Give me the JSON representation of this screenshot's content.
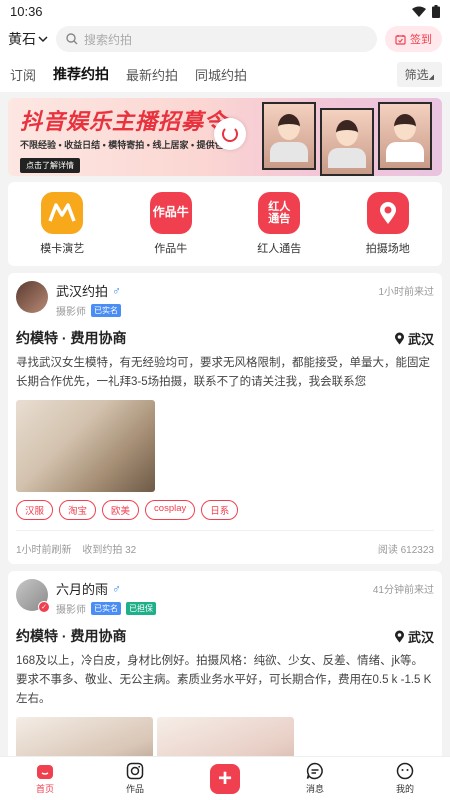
{
  "status_bar": {
    "time": "10:36"
  },
  "header": {
    "city": "黄石",
    "search_placeholder": "搜索约拍",
    "signin_label": "签到"
  },
  "tabs": [
    {
      "label": "订阅",
      "active": false
    },
    {
      "label": "推荐约拍",
      "active": true
    },
    {
      "label": "最新约拍",
      "active": false
    },
    {
      "label": "同城约拍",
      "active": false
    }
  ],
  "filter_label": "筛选",
  "banner": {
    "headline": "抖音娱乐主播招募令",
    "sub": "不限经验 • 收益日结 • 模特寄拍 • 线上居家 • 提供包住",
    "detail_button": "点击了解详情"
  },
  "quick_links": [
    {
      "label": "模卡演艺",
      "icon_text": "M",
      "icon": "m-logo-icon",
      "color": "#f7a81b"
    },
    {
      "label": "作品牛",
      "icon_text": "作品牛",
      "icon": "works-icon",
      "color": "#f0404f"
    },
    {
      "label": "红人通告",
      "icon_text": "红人\n通告",
      "icon": "notice-icon",
      "color": "#f0404f"
    },
    {
      "label": "拍摄场地",
      "icon_text": "",
      "icon": "location-pin-icon",
      "color": "#f0404f"
    }
  ],
  "posts": [
    {
      "username": "武汉约拍",
      "gender_symbol": "♂",
      "role": "摄影师",
      "badges": [
        "已实名"
      ],
      "time_ago": "1小时前来过",
      "title": "约模特 · 费用协商",
      "location": "武汉",
      "description": "寻找武汉女生模特，有无经验均可，要求无风格限制，都能接受，单量大，能固定长期合作优先，一礼拜3-5场拍摄，联系不了的请关注我，我会联系您",
      "tags": [
        "汉服",
        "淘宝",
        "欧美",
        "cosplay",
        "日系"
      ],
      "refresh_time": "1小时前刷新",
      "received": "收到约拍 32",
      "reads": "阅读 612323"
    },
    {
      "username": "六月的雨",
      "gender_symbol": "♂",
      "role": "摄影师",
      "badges": [
        "已实名",
        "已担保"
      ],
      "time_ago": "41分钟前来过",
      "title": "约模特 · 费用协商",
      "location": "武汉",
      "description": "168及以上，冷白皮，身材比例好。拍摄风格：纯欲、少女、反差、情绪、jk等。要求不事多、敬业、无公主病。素质业务水平好，可长期合作，费用在0.5 k -1.5 K左右。"
    }
  ],
  "bottom_nav": [
    {
      "label": "首页",
      "icon": "home-icon",
      "active": true
    },
    {
      "label": "作品",
      "icon": "camera-icon",
      "active": false
    },
    {
      "label": "",
      "icon": "plus-icon",
      "active": false
    },
    {
      "label": "消息",
      "icon": "message-icon",
      "active": false
    },
    {
      "label": "我的",
      "icon": "profile-icon",
      "active": false
    }
  ]
}
